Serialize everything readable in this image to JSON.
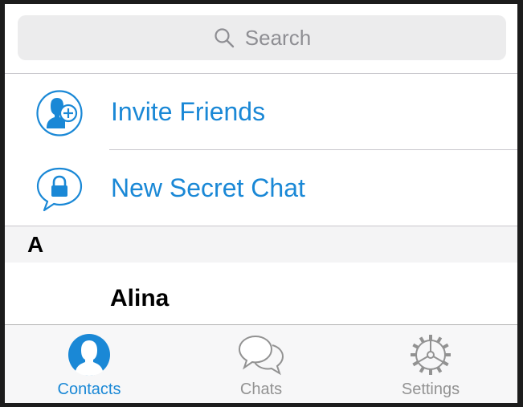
{
  "search": {
    "placeholder": "Search",
    "icon": "search-icon"
  },
  "actions": [
    {
      "label": "Invite Friends",
      "icon": "add-contact-icon"
    },
    {
      "label": "New Secret Chat",
      "icon": "lock-chat-icon"
    }
  ],
  "contacts": {
    "sections": [
      {
        "letter": "A",
        "items": [
          {
            "name": "Alina"
          }
        ]
      }
    ]
  },
  "tabbar": {
    "tabs": [
      {
        "label": "Contacts",
        "icon": "contacts-icon",
        "selected": true
      },
      {
        "label": "Chats",
        "icon": "chats-icon",
        "selected": false
      },
      {
        "label": "Settings",
        "icon": "settings-gear-icon",
        "selected": false
      }
    ]
  },
  "colors": {
    "accent": "#1a88d6",
    "inactive": "#929292",
    "search_bg": "#ececed",
    "section_bg": "#f4f4f5"
  }
}
